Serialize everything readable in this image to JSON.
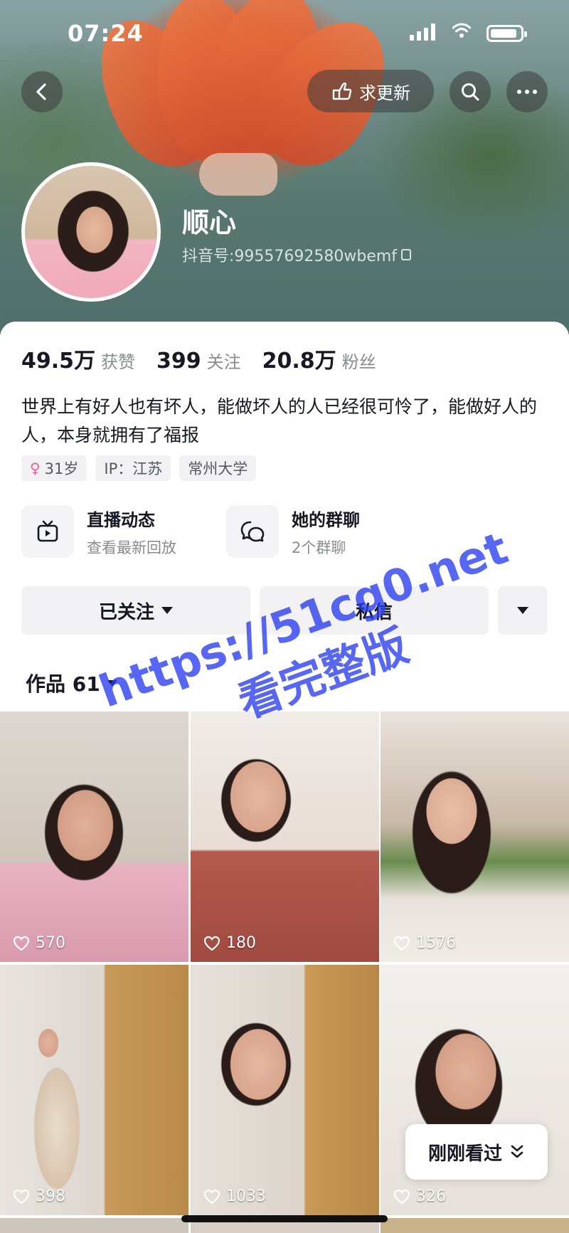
{
  "status_bar": {
    "time": "07:24"
  },
  "top_bar": {
    "update_label": "求更新"
  },
  "profile": {
    "name": "顺心",
    "douyin_id": "抖音号:99557692580wbemf"
  },
  "stats": [
    {
      "value": "49.5万",
      "label": "获赞"
    },
    {
      "value": "399",
      "label": "关注"
    },
    {
      "value": "20.8万",
      "label": "粉丝"
    }
  ],
  "bio": "世界上有好人也有坏人，能做坏人的人已经很可怜了，能做好人的人，本身就拥有了福报",
  "tags": {
    "age": "31岁",
    "ip": "IP：江苏",
    "school": "常州大学"
  },
  "quick_links": [
    {
      "title": "直播动态",
      "subtitle": "查看最新回放"
    },
    {
      "title": "她的群聊",
      "subtitle": "2个群聊"
    }
  ],
  "actions": {
    "follow": "已关注",
    "message": "私信"
  },
  "works_tab": {
    "label": "作品 61"
  },
  "videos": [
    {
      "likes": "570"
    },
    {
      "likes": "180"
    },
    {
      "likes": "1576"
    },
    {
      "likes": "398"
    },
    {
      "likes": "1033"
    },
    {
      "likes": "326"
    }
  ],
  "recently_watched": "刚刚看过",
  "watermark": {
    "line1": "https://51cg0.net",
    "line2": "看完整版"
  },
  "colors": {
    "accent_female": "#f05a9b",
    "watermark": "#2c40f0"
  }
}
